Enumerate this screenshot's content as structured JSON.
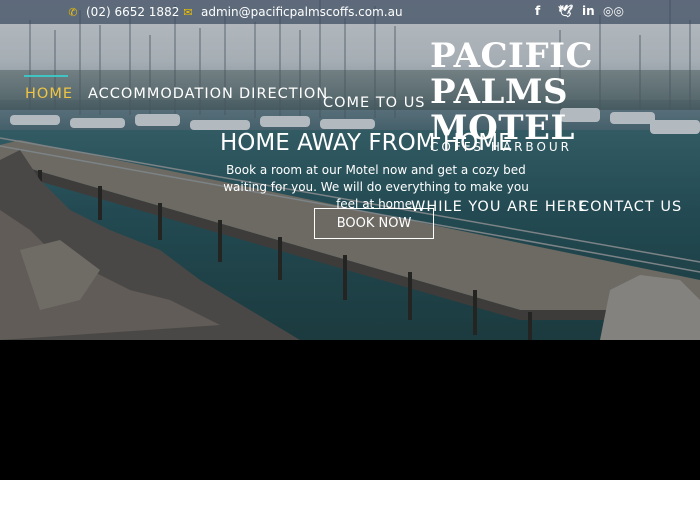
{
  "topbar": {
    "phone": "(02) 6652 1882",
    "email": "admin@pacificpalmscoffs.com.au",
    "phone_icon": "phone-icon",
    "email_icon": "envelope-icon",
    "social": [
      {
        "name": "facebook-icon",
        "glyph": "f"
      },
      {
        "name": "twitter-icon",
        "glyph": "🐦"
      },
      {
        "name": "linkedin-icon",
        "glyph": "in"
      },
      {
        "name": "tripadvisor-icon",
        "glyph": "◎◎"
      }
    ]
  },
  "nav": {
    "home": "HOME",
    "accommodation": "ACCOMMODATION",
    "direction": "DIRECTION",
    "come_to_us": "COME TO US",
    "while_you_are_here": "WHILE YOU ARE HERE",
    "contact_us": "CONTACT US"
  },
  "logo": {
    "line1": "PACIFIC",
    "line2": "PALMS",
    "line3": "MOTEL",
    "subtitle": "COFFS HARBOUR"
  },
  "hero": {
    "title": "HOME AWAY FROM HOME",
    "text": "Book a room at our Motel now and get a cozy bed waiting for you. We will do everything to make you feel at home.",
    "button": "BOOK NOW"
  },
  "colors": {
    "accent": "#f0c542",
    "active_underline": "#3fc3c3",
    "icon_yellow": "#f0c000",
    "topbar": "#3c4b5f"
  }
}
